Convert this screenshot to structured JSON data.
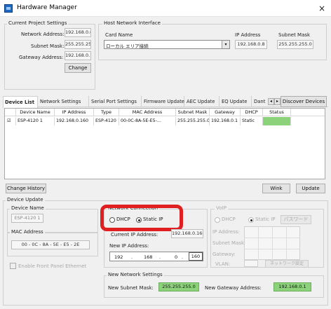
{
  "window": {
    "title": "Hardware Manager",
    "close": "×"
  },
  "current_project": {
    "title": "Current Project Settings",
    "network_address_label": "Network Address:",
    "network_address": "192.168.0.0",
    "subnet_mask_label": "Subnet Mask:",
    "subnet_mask": "255.255.255.0",
    "gateway_label": "Gateway Address:",
    "gateway": "192.168.0.1",
    "change_button": "Change"
  },
  "host_interface": {
    "title": "Host Network Interface",
    "card_name_label": "Card Name",
    "card_name": "ローカル エリア接続",
    "ip_label": "IP Address",
    "ip": "192.168.0.8",
    "subnet_label": "Subnet Mask",
    "subnet": "255.255.255.0"
  },
  "tabs": [
    "Device List",
    "Network Settings",
    "Serial Port Settings",
    "Firmware Update",
    "AEC Update",
    "EQ Update",
    "Dant"
  ],
  "tab_scroll": {
    "left": "◂",
    "right": "▸"
  },
  "discover_button": "Discover Devices",
  "table": {
    "headers": [
      "",
      "Device Name",
      "IP Address",
      "Type",
      "MAC Address",
      "Subnet Mask",
      "Gateway",
      "DHCP",
      "Status"
    ],
    "row": {
      "checked": "☑",
      "name": "ESP-4120 1",
      "ip": "192.168.0.160",
      "type": "ESP-4120",
      "mac": "00-0C-8A-5E-E5-...",
      "subnet": "255.255.255.0",
      "gateway": "192.168.0.1",
      "dhcp": "Static",
      "status_color": "#8cd27a"
    }
  },
  "bottom_buttons": {
    "history": "Change History",
    "wink": "Wink",
    "update": "Update"
  },
  "device_update": {
    "title": "Device Update",
    "device_name_label": "Device Name",
    "device_name": "ESP-4120 1",
    "mac_label": "MAC Address",
    "mac": "00 - 0C - 8A - 5E - E5 - 2E",
    "front_panel": "Enable Front Panel Ethernet"
  },
  "network_connection": {
    "title": "Network Connection",
    "dhcp": "DHCP",
    "static": "Static IP",
    "current_ip_label": "Current IP Address:",
    "current_ip": "192.168.0.160",
    "new_ip_label": "New IP Address:",
    "new_ip": [
      "192",
      "168",
      "0",
      "160"
    ]
  },
  "voip": {
    "title": "VoIP",
    "dhcp": "DHCP",
    "static": "Static IP",
    "apply": "パスワード",
    "ip_label": "IP Address:",
    "subnet_label": "Subnet Mask:",
    "gateway_label": "Gateway:",
    "vlan_label": "VLAN:",
    "setting_button": "ネットワーク設定"
  },
  "new_network": {
    "title": "New Network Settings",
    "subnet_label": "New Subnet Mask:",
    "subnet": "255.255.255.0",
    "gateway_label": "New Gateway Address:",
    "gateway": "192.168.0.1"
  },
  "highlight_color": "#e02020"
}
